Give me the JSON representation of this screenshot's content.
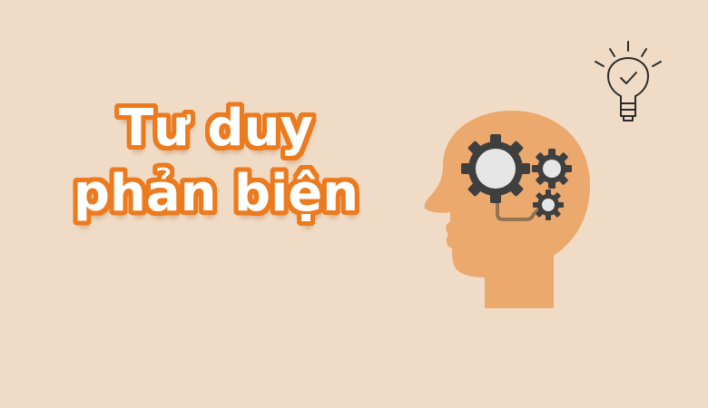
{
  "headline": {
    "line1": "Tư duy",
    "line2": "phản biện"
  },
  "colors": {
    "background": "#f0dcc6",
    "title_fill": "#ffffff",
    "title_outline": "#ec7a1f",
    "head": "#eba96e",
    "gear_dark": "#3f3f3f",
    "gear_light": "#e6e6e6",
    "icon_line": "#2b2b2b"
  },
  "icons": {
    "head": "head-with-gears-icon",
    "bulb": "lightbulb-check-icon"
  }
}
